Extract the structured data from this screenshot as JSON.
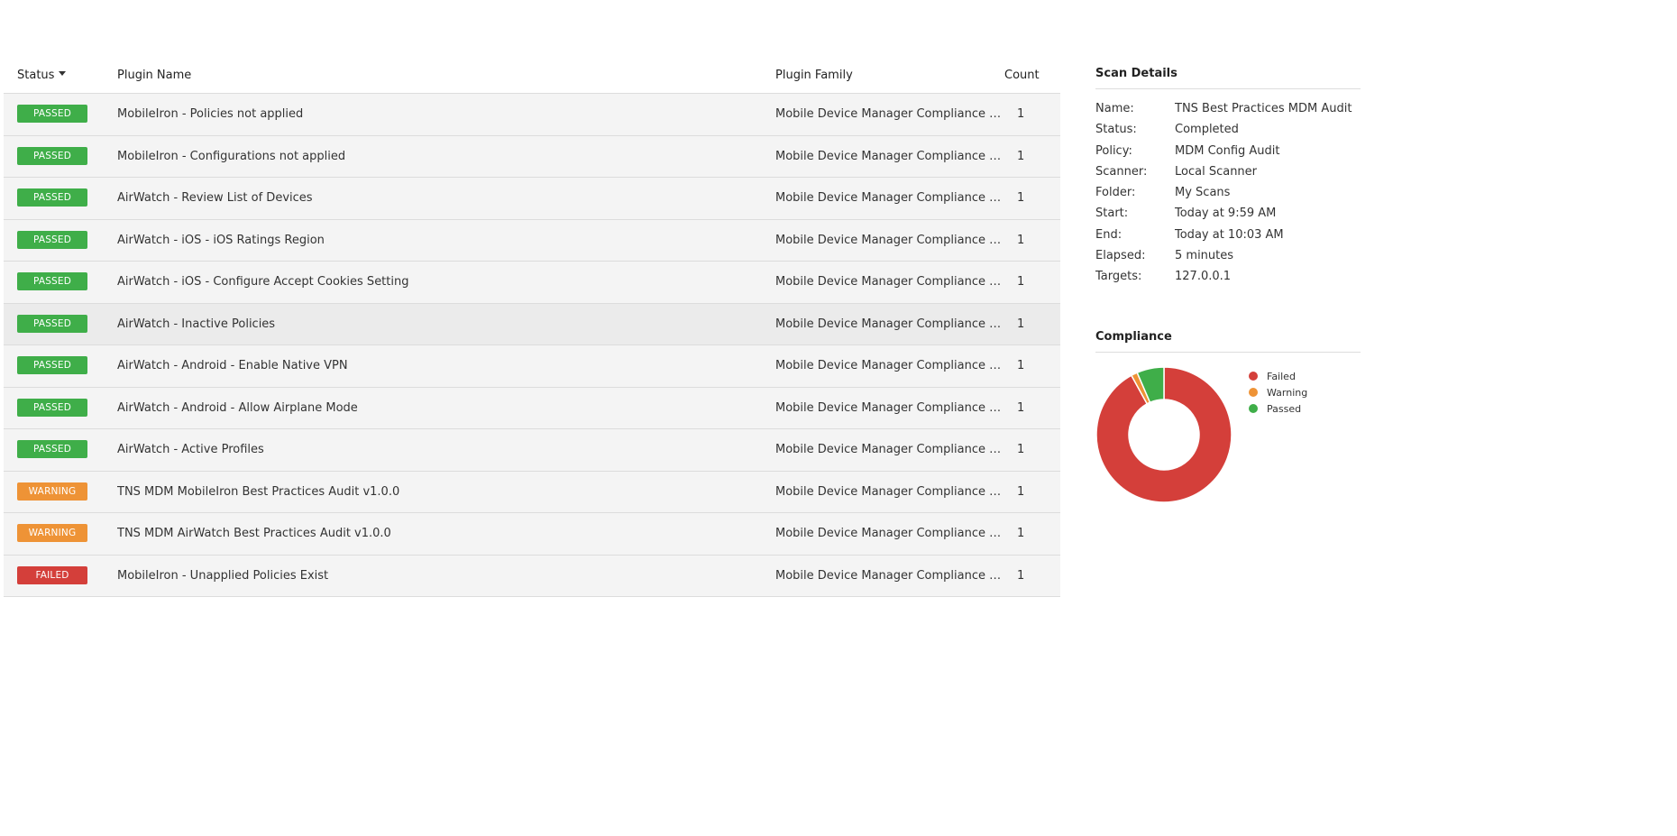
{
  "table": {
    "headers": {
      "status": "Status",
      "plugin_name": "Plugin Name",
      "plugin_family": "Plugin Family",
      "count": "Count"
    },
    "rows": [
      {
        "status": "PASSED",
        "status_kind": "passed",
        "name": "MobileIron - Policies not applied",
        "family": "Mobile Device Manager Compliance Checks",
        "count": "1"
      },
      {
        "status": "PASSED",
        "status_kind": "passed",
        "name": "MobileIron - Configurations not applied",
        "family": "Mobile Device Manager Compliance Checks",
        "count": "1"
      },
      {
        "status": "PASSED",
        "status_kind": "passed",
        "name": "AirWatch - Review List of Devices",
        "family": "Mobile Device Manager Compliance Checks",
        "count": "1"
      },
      {
        "status": "PASSED",
        "status_kind": "passed",
        "name": "AirWatch - iOS - iOS Ratings Region",
        "family": "Mobile Device Manager Compliance Checks",
        "count": "1"
      },
      {
        "status": "PASSED",
        "status_kind": "passed",
        "name": "AirWatch - iOS - Configure Accept Cookies Setting",
        "family": "Mobile Device Manager Compliance Checks",
        "count": "1"
      },
      {
        "status": "PASSED",
        "status_kind": "passed",
        "name": "AirWatch - Inactive Policies",
        "family": "Mobile Device Manager Compliance Checks",
        "count": "1"
      },
      {
        "status": "PASSED",
        "status_kind": "passed",
        "name": "AirWatch - Android - Enable Native VPN",
        "family": "Mobile Device Manager Compliance Checks",
        "count": "1"
      },
      {
        "status": "PASSED",
        "status_kind": "passed",
        "name": "AirWatch - Android - Allow Airplane Mode",
        "family": "Mobile Device Manager Compliance Checks",
        "count": "1"
      },
      {
        "status": "PASSED",
        "status_kind": "passed",
        "name": "AirWatch - Active Profiles",
        "family": "Mobile Device Manager Compliance Checks",
        "count": "1"
      },
      {
        "status": "WARNING",
        "status_kind": "warning",
        "name": "TNS MDM MobileIron Best Practices Audit v1.0.0",
        "family": "Mobile Device Manager Compliance Checks",
        "count": "1"
      },
      {
        "status": "WARNING",
        "status_kind": "warning",
        "name": "TNS MDM AirWatch Best Practices Audit v1.0.0",
        "family": "Mobile Device Manager Compliance Checks",
        "count": "1"
      },
      {
        "status": "FAILED",
        "status_kind": "failed",
        "name": "MobileIron - Unapplied Policies Exist",
        "family": "Mobile Device Manager Compliance Checks",
        "count": "1"
      }
    ]
  },
  "scan_details": {
    "title": "Scan Details",
    "fields": [
      {
        "label": "Name:",
        "value": "TNS Best Practices MDM Audit"
      },
      {
        "label": "Status:",
        "value": "Completed"
      },
      {
        "label": "Policy:",
        "value": "MDM Config Audit"
      },
      {
        "label": "Scanner:",
        "value": "Local Scanner"
      },
      {
        "label": "Folder:",
        "value": "My Scans"
      },
      {
        "label": "Start:",
        "value": "Today at 9:59 AM"
      },
      {
        "label": "End:",
        "value": "Today at 10:03 AM"
      },
      {
        "label": "Elapsed:",
        "value": "5 minutes"
      },
      {
        "label": "Targets:",
        "value": "127.0.0.1"
      }
    ]
  },
  "compliance": {
    "title": "Compliance",
    "chart_data": {
      "type": "pie",
      "style": "donut",
      "categories": [
        "Failed",
        "Warning",
        "Passed"
      ],
      "values": [
        92,
        1.5,
        6.5
      ],
      "colors": [
        "#d43f3a",
        "#ee9336",
        "#3fae49"
      ],
      "legend": "right"
    }
  },
  "colors": {
    "passed": "#3fae49",
    "warning": "#ee9336",
    "failed": "#d43f3a"
  }
}
